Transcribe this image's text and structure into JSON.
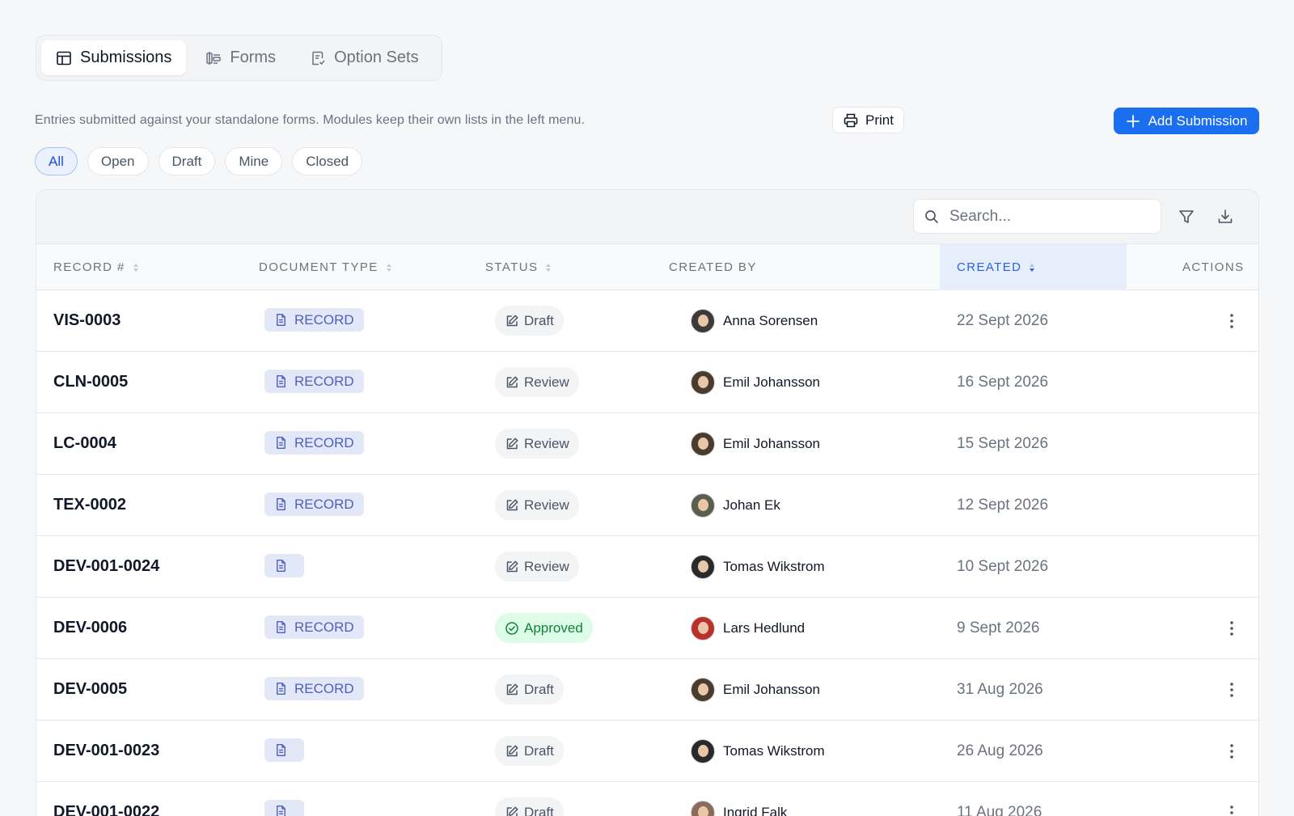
{
  "tabs": [
    {
      "label": "Submissions",
      "icon": "table-icon",
      "active": true
    },
    {
      "label": "Forms",
      "icon": "form-icon",
      "active": false
    },
    {
      "label": "Option Sets",
      "icon": "checklist-icon",
      "active": false
    }
  ],
  "description": "Entries submitted against your standalone forms. Modules keep their own lists in the left menu.",
  "print_label": "Print",
  "add_label": "Add Submission",
  "filters": [
    {
      "label": "All",
      "active": true
    },
    {
      "label": "Open",
      "active": false
    },
    {
      "label": "Draft",
      "active": false
    },
    {
      "label": "Mine",
      "active": false
    },
    {
      "label": "Closed",
      "active": false
    }
  ],
  "search": {
    "placeholder": "Search..."
  },
  "columns": {
    "record": "RECORD #",
    "doctype": "DOCUMENT TYPE",
    "status": "STATUS",
    "created_by": "CREATED BY",
    "created": "CREATED",
    "actions": "ACTIONS"
  },
  "rows": [
    {
      "record": "VIS-0003",
      "doc_label": "RECORD",
      "status": "Draft",
      "creator": "Anna Sorensen",
      "created": "22 Sept 2026",
      "has_actions": true,
      "avatar_color": "#3f3a3a"
    },
    {
      "record": "CLN-0005",
      "doc_label": "RECORD",
      "status": "Review",
      "creator": "Emil Johansson",
      "created": "16 Sept 2026",
      "has_actions": false,
      "avatar_color": "#4a3b2c"
    },
    {
      "record": "LC-0004",
      "doc_label": "RECORD",
      "status": "Review",
      "creator": "Emil Johansson",
      "created": "15 Sept 2026",
      "has_actions": false,
      "avatar_color": "#4a3b2c"
    },
    {
      "record": "TEX-0002",
      "doc_label": "RECORD",
      "status": "Review",
      "creator": "Johan Ek",
      "created": "12 Sept 2026",
      "has_actions": false,
      "avatar_color": "#5a5f4d"
    },
    {
      "record": "DEV-001-0024",
      "doc_label": "",
      "status": "Review",
      "creator": "Tomas Wikstrom",
      "created": "10 Sept 2026",
      "has_actions": false,
      "avatar_color": "#2a2a2a"
    },
    {
      "record": "DEV-0006",
      "doc_label": "RECORD",
      "status": "Approved",
      "creator": "Lars Hedlund",
      "created": "9 Sept 2026",
      "has_actions": true,
      "avatar_color": "#b8322a"
    },
    {
      "record": "DEV-0005",
      "doc_label": "RECORD",
      "status": "Draft",
      "creator": "Emil Johansson",
      "created": "31 Aug 2026",
      "has_actions": true,
      "avatar_color": "#4a3b2c"
    },
    {
      "record": "DEV-001-0023",
      "doc_label": "",
      "status": "Draft",
      "creator": "Tomas Wikstrom",
      "created": "26 Aug 2026",
      "has_actions": true,
      "avatar_color": "#2a2a2a"
    },
    {
      "record": "DEV-001-0022",
      "doc_label": "",
      "status": "Draft",
      "creator": "Ingrid Falk",
      "created": "11 Aug 2026",
      "has_actions": true,
      "avatar_color": "#8a6b58"
    }
  ],
  "colors": {
    "accent": "#1a6ef0",
    "approved_bg": "#dcfce7",
    "approved_text": "#15803d",
    "badge_bg": "#e2e8f8"
  }
}
